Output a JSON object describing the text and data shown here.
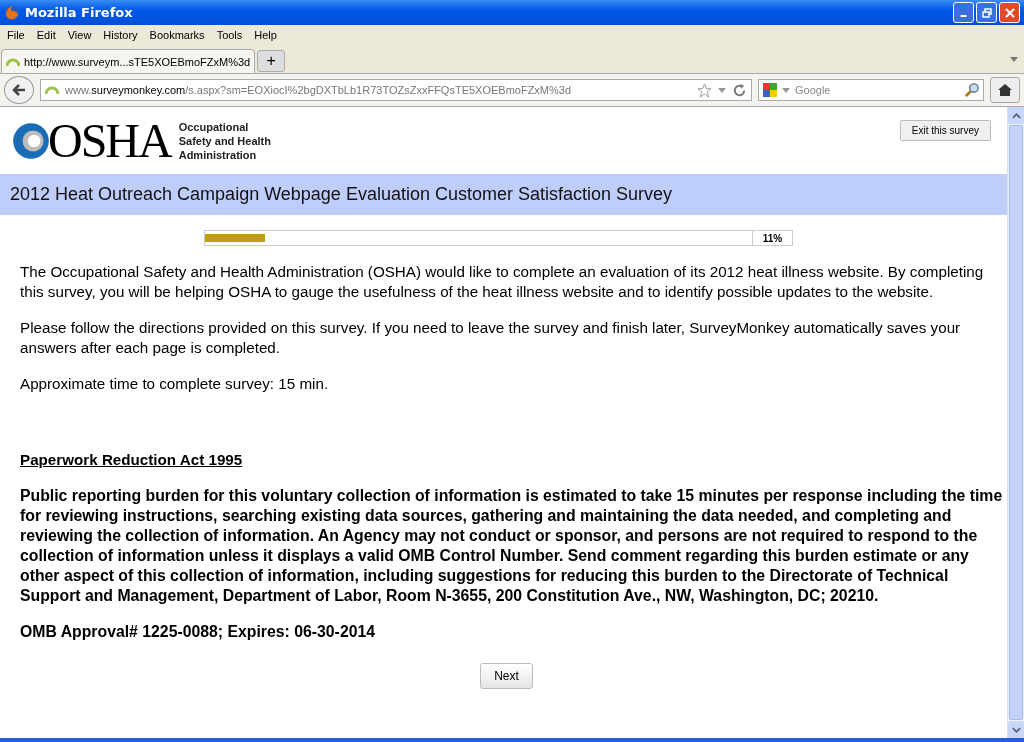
{
  "window": {
    "title": "Mozilla Firefox"
  },
  "menu": [
    "File",
    "Edit",
    "View",
    "History",
    "Bookmarks",
    "Tools",
    "Help"
  ],
  "tabs": [
    {
      "label": "http://www.surveym...sTE5XOEBmoFZxM%3d",
      "selected": true
    }
  ],
  "new_tab": "+",
  "address_bar": {
    "host_prefix": "www.",
    "host": "surveymonkey.com",
    "path": "/s.aspx?sm=EOXiocI%2bgDXTbLb1R73TOZsZxxFFQsTE5XOEBmoFZxM%3d"
  },
  "search": {
    "placeholder": "Google"
  },
  "logo": {
    "wordmark": "OSHA",
    "lines": [
      "Occupational",
      "Safety and Health",
      "Administration"
    ]
  },
  "exit_button": "Exit this survey",
  "survey_title": "2012 Heat Outreach Campaign Webpage Evaluation Customer Satisfaction Survey",
  "progress": {
    "level": 0.11,
    "reading": "11%"
  },
  "intro": [
    "The Occupational Safety and Health Administration (OSHA) would like to complete an evaluation of its 2012 heat illness website. By completing this survey, you will be helping OSHA to gauge the usefulness of the heat illness website and to identify possible updates to the website.",
    "Please follow the directions provided on this survey. If you need to leave the survey and finish later, SurveyMonkey automatically saves your answers after each page is completed.",
    "Approximate time to complete survey: 15 min."
  ],
  "act_heading": "Paperwork Reduction Act 1995",
  "act_text": "Public reporting burden for this voluntary collection of information is estimated to take 15 minutes per response including the time for reviewing instructions, searching existing data sources, gathering and maintaining the data needed, and completing and reviewing the collection of information. An Agency may not conduct or sponsor, and persons are not required to respond to the collection of information unless it displays a valid OMB Control Number. Send comment regarding this burden estimate or any other aspect of this collection of information, including suggestions for reducing this burden to the Directorate of Technical Support and Management, Department of Labor, Room N-3655, 200 Constitution Ave., NW, Washington, DC; 20210.",
  "omb": "OMB Approval# 1225-0088; Expires: 06-30-2014",
  "next_button": "Next"
}
